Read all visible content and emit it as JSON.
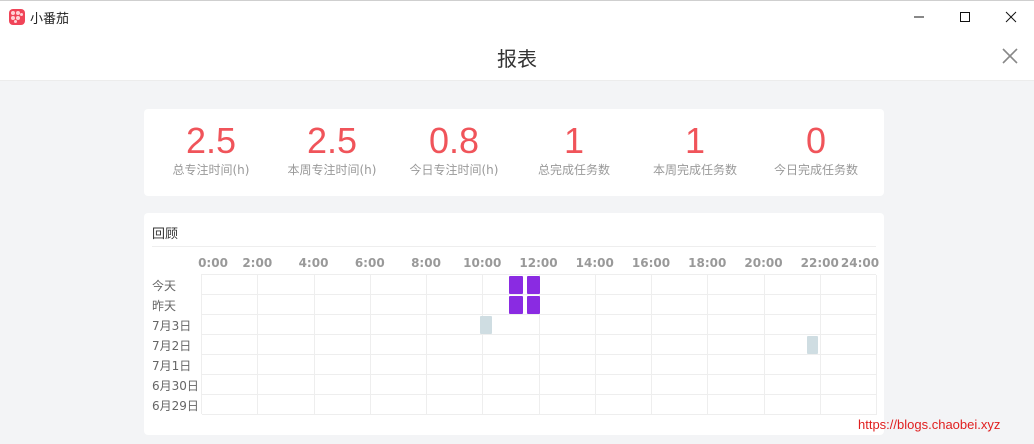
{
  "window": {
    "app_title": "小番茄",
    "app_icon": "tomato-app-icon",
    "controls": [
      "minimize-icon",
      "maximize-icon",
      "close-icon"
    ]
  },
  "header": {
    "title": "报表",
    "close_icon": "close-icon"
  },
  "stats": [
    {
      "value": "2.5",
      "label": "总专注时间(h)"
    },
    {
      "value": "2.5",
      "label": "本周专注时间(h)"
    },
    {
      "value": "0.8",
      "label": "今日专注时间(h)"
    },
    {
      "value": "1",
      "label": "总完成任务数"
    },
    {
      "value": "1",
      "label": "本周完成任务数"
    },
    {
      "value": "0",
      "label": "今日完成任务数"
    }
  ],
  "review": {
    "title": "回顾",
    "hours": [
      "0:00",
      "2:00",
      "4:00",
      "6:00",
      "8:00",
      "10:00",
      "12:00",
      "14:00",
      "16:00",
      "18:00",
      "20:00",
      "22:00",
      "24:00"
    ],
    "days": [
      "今天",
      "昨天",
      "7月3日",
      "7月2日",
      "7月1日",
      "6月30日",
      "6月29日"
    ],
    "blocks": [
      {
        "day_index": 0,
        "start_h": 10.9,
        "end_h": 11.4,
        "kind": "focus"
      },
      {
        "day_index": 0,
        "start_h": 11.55,
        "end_h": 12.0,
        "kind": "focus"
      },
      {
        "day_index": 1,
        "start_h": 10.9,
        "end_h": 11.4,
        "kind": "focus"
      },
      {
        "day_index": 1,
        "start_h": 11.55,
        "end_h": 12.0,
        "kind": "focus"
      },
      {
        "day_index": 2,
        "start_h": 9.9,
        "end_h": 10.3,
        "kind": "other"
      },
      {
        "day_index": 3,
        "start_h": 21.5,
        "end_h": 21.9,
        "kind": "other"
      }
    ],
    "colors": {
      "focus": "#8a2be2",
      "other": "#cfdde2",
      "grid": "#eeeeee"
    }
  },
  "watermark": "https://blogs.chaobei.xyz",
  "colors": {
    "accent": "#f0545a",
    "background": "#f3f4f6"
  }
}
